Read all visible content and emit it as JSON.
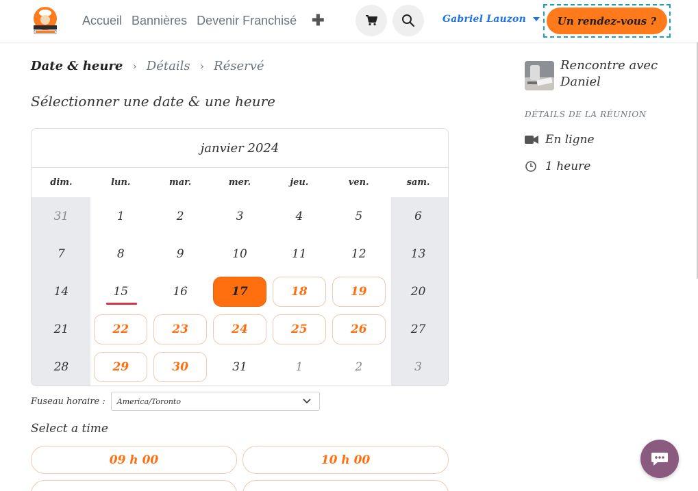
{
  "header": {
    "logo_alt": "logo",
    "nav": [
      "Accueil",
      "Bannières",
      "Devenir Franchisé"
    ],
    "user_name": "Gabriel Lauzon",
    "cta_label": "Un rendez-vous ?"
  },
  "breadcrumb": {
    "steps": [
      "Date & heure",
      "Détails",
      "Réservé"
    ]
  },
  "section_title": "Sélectionner une date & une heure",
  "calendar": {
    "month": "janvier 2024",
    "weekdays": [
      "dim.",
      "lun.",
      "mar.",
      "mer.",
      "jeu.",
      "ven.",
      "sam."
    ],
    "weeks": [
      [
        {
          "d": "31",
          "s": "muted"
        },
        {
          "d": "1",
          "s": ""
        },
        {
          "d": "2",
          "s": ""
        },
        {
          "d": "3",
          "s": ""
        },
        {
          "d": "4",
          "s": ""
        },
        {
          "d": "5",
          "s": ""
        },
        {
          "d": "6",
          "s": ""
        }
      ],
      [
        {
          "d": "7",
          "s": ""
        },
        {
          "d": "8",
          "s": ""
        },
        {
          "d": "9",
          "s": ""
        },
        {
          "d": "10",
          "s": ""
        },
        {
          "d": "11",
          "s": ""
        },
        {
          "d": "12",
          "s": ""
        },
        {
          "d": "13",
          "s": ""
        }
      ],
      [
        {
          "d": "14",
          "s": ""
        },
        {
          "d": "15",
          "s": "today"
        },
        {
          "d": "16",
          "s": ""
        },
        {
          "d": "17",
          "s": "selected"
        },
        {
          "d": "18",
          "s": "available"
        },
        {
          "d": "19",
          "s": "available"
        },
        {
          "d": "20",
          "s": ""
        }
      ],
      [
        {
          "d": "21",
          "s": ""
        },
        {
          "d": "22",
          "s": "available"
        },
        {
          "d": "23",
          "s": "available"
        },
        {
          "d": "24",
          "s": "available"
        },
        {
          "d": "25",
          "s": "available"
        },
        {
          "d": "26",
          "s": "available"
        },
        {
          "d": "27",
          "s": ""
        }
      ],
      [
        {
          "d": "28",
          "s": ""
        },
        {
          "d": "29",
          "s": "available"
        },
        {
          "d": "30",
          "s": "available"
        },
        {
          "d": "31",
          "s": ""
        },
        {
          "d": "1",
          "s": "muted"
        },
        {
          "d": "2",
          "s": "muted"
        },
        {
          "d": "3",
          "s": "muted"
        }
      ]
    ]
  },
  "timezone": {
    "label": "Fuseau horaire :",
    "value": "America/Toronto"
  },
  "time_section": {
    "label": "Select a time",
    "slots": [
      "09 h 00",
      "10 h 00"
    ]
  },
  "meeting": {
    "title": "Rencontre avec Daniel",
    "details_label": "DÉTAILS DE LA RÉUNION",
    "location": "En ligne",
    "duration": "1 heure"
  },
  "colors": {
    "accent": "#ff6f0f",
    "user_link": "#1a73e8",
    "focus_outline": "#17a2b8",
    "today_marker": "#d63447",
    "chat_button": "#8a5b7e"
  },
  "icons": {
    "cart": "cart-icon",
    "search": "search-icon",
    "add": "plus-icon",
    "video": "video-camera-icon",
    "clock": "clock-icon",
    "chat": "chat-bubble-icon",
    "chevron": "chevron-down-icon"
  }
}
